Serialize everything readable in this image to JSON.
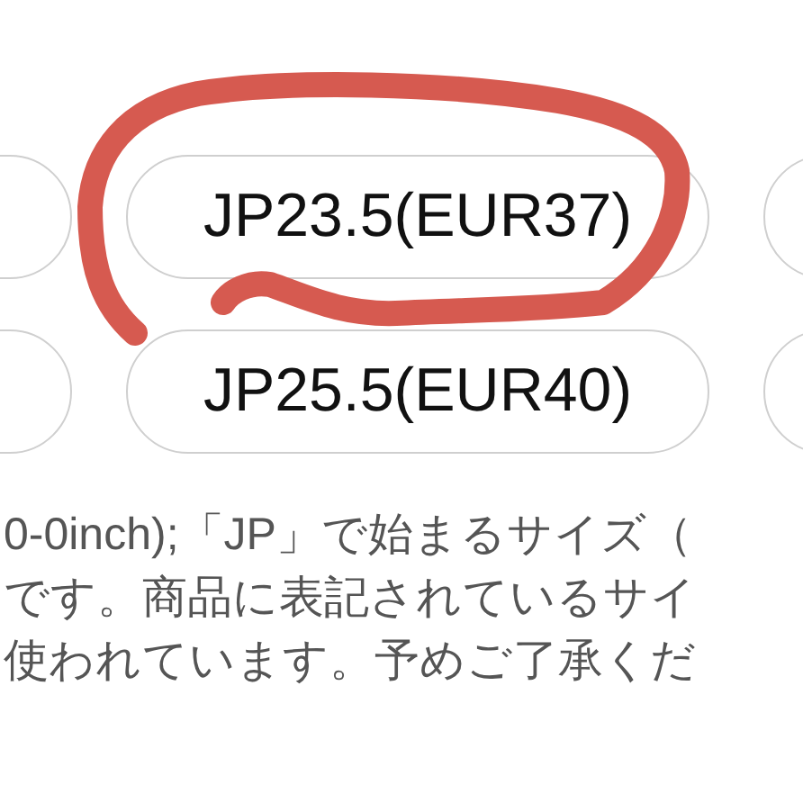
{
  "size_rows": [
    {
      "options": [
        {
          "kind": "edge"
        },
        {
          "kind": "full",
          "label": "JP23.5(EUR37)"
        },
        {
          "kind": "edge"
        }
      ]
    },
    {
      "options": [
        {
          "kind": "edge"
        },
        {
          "kind": "full",
          "label": "JP25.5(EUR40)"
        },
        {
          "kind": "edge"
        }
      ]
    }
  ],
  "note_lines": [
    "0-0inch);「JP」で始まるサイズ（",
    "です。商品に表記されているサイ",
    "使われています。予めご了承くだ"
  ],
  "annotation": {
    "kind": "scribble"
  }
}
